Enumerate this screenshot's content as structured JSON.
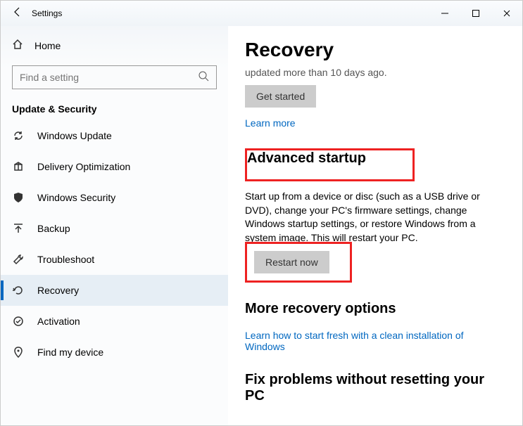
{
  "titlebar": {
    "title": "Settings"
  },
  "sidebar": {
    "home": "Home",
    "search_placeholder": "Find a setting",
    "category": "Update & Security",
    "items": [
      {
        "label": "Windows Update",
        "icon": "sync-icon"
      },
      {
        "label": "Delivery Optimization",
        "icon": "delivery-icon"
      },
      {
        "label": "Windows Security",
        "icon": "shield-icon"
      },
      {
        "label": "Backup",
        "icon": "backup-icon"
      },
      {
        "label": "Troubleshoot",
        "icon": "wrench-icon"
      },
      {
        "label": "Recovery",
        "icon": "recovery-icon"
      },
      {
        "label": "Activation",
        "icon": "check-icon"
      },
      {
        "label": "Find my device",
        "icon": "location-icon"
      }
    ]
  },
  "main": {
    "page_title": "Recovery",
    "cut_text": "updated more than 10 days ago.",
    "get_started": "Get started",
    "learn_more": "Learn more",
    "advanced_heading": "Advanced startup",
    "advanced_desc": "Start up from a device or disc (such as a USB drive or DVD), change your PC's firmware settings, change Windows startup settings, or restore Windows from a system image. This will restart your PC.",
    "restart_now": "Restart now",
    "more_heading": "More recovery options",
    "more_link": "Learn how to start fresh with a clean installation of Windows",
    "fix_heading": "Fix problems without resetting your PC"
  }
}
